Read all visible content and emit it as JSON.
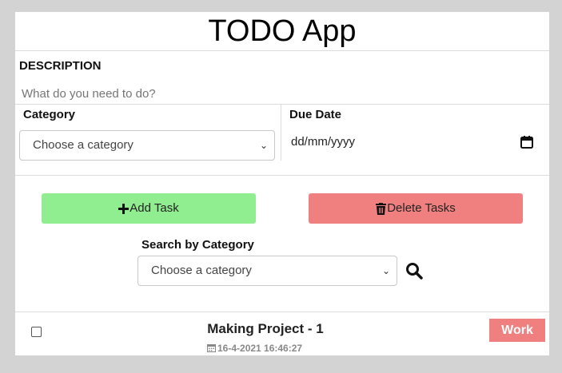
{
  "app": {
    "title": "TODO App"
  },
  "form": {
    "description_label": "DESCRIPTION",
    "description_placeholder": "What do you need to do?",
    "category_label": "Category",
    "category_selected": "Choose a category",
    "due_date_label": "Due Date",
    "due_date_value": "dd/mm/yyyy"
  },
  "actions": {
    "add_label": "Add Task",
    "delete_label": "Delete Tasks",
    "add_color": "#90ee90",
    "delete_color": "#f08080"
  },
  "search": {
    "label": "Search by Category",
    "selected": "Choose a category"
  },
  "tasks": [
    {
      "title": "Making Project - 1",
      "date": "16-4-2021 16:46:27",
      "category": "Work",
      "checked": false
    }
  ],
  "icons": {
    "add": "plus-icon",
    "delete": "trash-icon",
    "search": "search-icon",
    "calendar": "calendar-icon",
    "select": "chevron-down-icon"
  }
}
